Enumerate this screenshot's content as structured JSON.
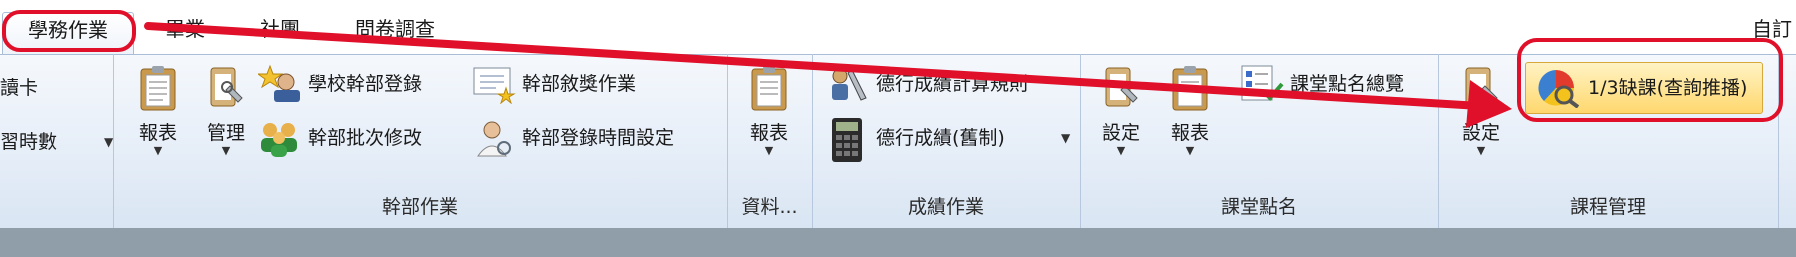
{
  "tabs": [
    "學務作業",
    "畢業",
    "社團",
    "問卷調查"
  ],
  "tabs_right": "自訂",
  "left_partial": {
    "item1": "學讀卡",
    "item2": "學習時數"
  },
  "group_cadre": {
    "label": "幹部作業",
    "report": "報表",
    "manage": "管理",
    "school_cadre": "學校幹部登錄",
    "batch_edit": "幹部批次修改",
    "reward": "幹部敘獎作業",
    "time_setting": "幹部登錄時間設定"
  },
  "group_data": {
    "label": "資料...",
    "report": "報表"
  },
  "group_grades": {
    "label": "成績作業",
    "rule": "德行成績計算規則",
    "grades": "德行成績(舊制)"
  },
  "group_attendance": {
    "label": "課堂點名",
    "setting": "設定",
    "report": "報表",
    "overview": "課堂點名總覽"
  },
  "group_course": {
    "label": "課程管理",
    "absence": "1/3缺課(查詢推播)",
    "setting": "設定"
  },
  "colors": {
    "annotation": "#e0102a",
    "highlight": "#ffd86e",
    "ribbon": "#e6eef8"
  }
}
